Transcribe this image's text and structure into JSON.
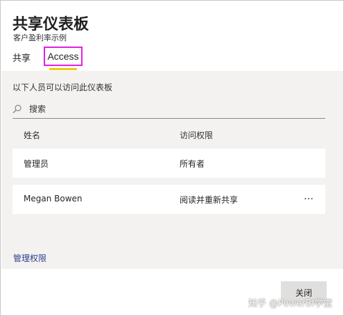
{
  "header": {
    "title": "共享仪表板",
    "subtitle": "客户盈利率示例"
  },
  "tabs": [
    {
      "label": "共享"
    },
    {
      "label": "Access",
      "active": true
    }
  ],
  "panel": {
    "heading": "以下人员可以访问此仪表板",
    "search_placeholder": "搜索",
    "columns": {
      "name": "姓名",
      "permission": "访问权限"
    },
    "rows": [
      {
        "name": "管理员",
        "permission": "所有者"
      },
      {
        "name": "Megan Bowen",
        "permission": "阅读并重新共享",
        "more": "…"
      }
    ]
  },
  "manage_link": "管理权限",
  "footer": {
    "close_label": "关闭"
  },
  "watermark": "知乎 @PowerBI学堂",
  "colors": {
    "active_tab_underline": "#f2c811",
    "highlight_border": "#e31ee3",
    "link": "#2e3d8f",
    "panel_bg": "#f3f2f1"
  },
  "icons": {
    "search": "search-icon",
    "more": "more-options-icon"
  }
}
